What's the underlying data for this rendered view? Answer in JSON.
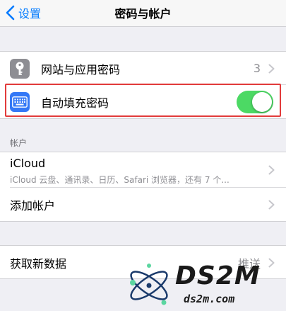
{
  "nav": {
    "back_label": "设置",
    "title": "密码与帐户"
  },
  "passwords": {
    "websites_label": "网站与应用密码",
    "websites_count": "3",
    "autofill_label": "自动填充密码",
    "autofill_enabled": true
  },
  "accounts": {
    "header": "帐户",
    "icloud_title": "iCloud",
    "icloud_subtitle": "iCloud 云盘、通讯录、日历、Safari 浏览器，还有 7 个...",
    "add_account_label": "添加帐户"
  },
  "fetch": {
    "label": "获取新数据",
    "value": "推送"
  },
  "watermark": {
    "brand": "DS2M",
    "domain": "ds2m.com"
  },
  "colors": {
    "accent": "#007aff",
    "toggle_on": "#4cd964",
    "highlight": "#e23b3b",
    "keyboard_icon_bg": "#3478f6",
    "key_icon_bg": "#8e8e93"
  },
  "icons": {
    "websites": "key-icon",
    "autofill": "keyboard-icon"
  }
}
